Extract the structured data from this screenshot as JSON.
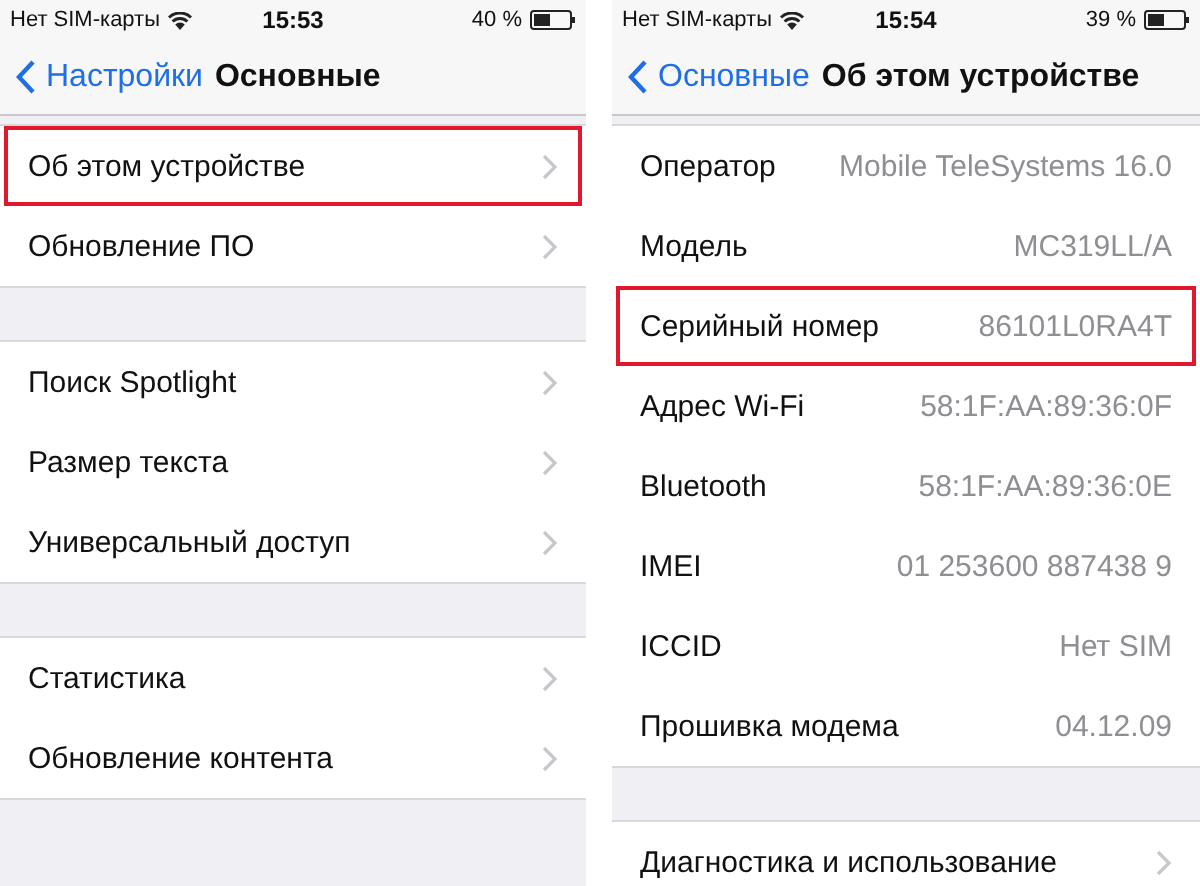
{
  "screens": [
    {
      "status_bar": {
        "carrier": "Нет SIM-карты",
        "time": "15:53",
        "battery": "40 %"
      },
      "nav": {
        "back": "Настройки",
        "title": "Основные"
      },
      "groups": [
        {
          "rows": [
            {
              "kind": "disclosure",
              "label": "Об этом устройстве",
              "highlighted": true
            },
            {
              "kind": "disclosure",
              "label": "Обновление ПО",
              "highlighted": false
            }
          ]
        },
        {
          "rows": [
            {
              "kind": "disclosure",
              "label": "Поиск Spotlight",
              "highlighted": false
            },
            {
              "kind": "disclosure",
              "label": "Размер текста",
              "highlighted": false
            },
            {
              "kind": "disclosure",
              "label": "Универсальный доступ",
              "highlighted": false
            }
          ]
        },
        {
          "rows": [
            {
              "kind": "disclosure",
              "label": "Статистика",
              "highlighted": false
            },
            {
              "kind": "disclosure",
              "label": "Обновление контента",
              "highlighted": false
            }
          ]
        }
      ]
    },
    {
      "status_bar": {
        "carrier": "Нет SIM-карты",
        "time": "15:54",
        "battery": "39 %"
      },
      "nav": {
        "back": "Основные",
        "title": "Об этом устройстве"
      },
      "groups": [
        {
          "rows": [
            {
              "kind": "info",
              "label": "Оператор",
              "value": "Mobile TeleSystems 16.0",
              "highlighted": false
            },
            {
              "kind": "info",
              "label": "Модель",
              "value": "MC319LL/A",
              "highlighted": false
            },
            {
              "kind": "info",
              "label": "Серийный номер",
              "value": "86101L0RA4T",
              "highlighted": true
            },
            {
              "kind": "info",
              "label": "Адрес Wi-Fi",
              "value": "58:1F:AA:89:36:0F",
              "highlighted": false
            },
            {
              "kind": "info",
              "label": "Bluetooth",
              "value": "58:1F:AA:89:36:0E",
              "highlighted": false
            },
            {
              "kind": "info",
              "label": "IMEI",
              "value": "01 253600 887438 9",
              "highlighted": false
            },
            {
              "kind": "info",
              "label": "ICCID",
              "value": "Нет SIM",
              "highlighted": false
            },
            {
              "kind": "info",
              "label": "Прошивка модема",
              "value": "04.12.09",
              "highlighted": false
            }
          ]
        },
        {
          "rows": [
            {
              "kind": "disclosure",
              "label": "Диагностика и использование",
              "highlighted": false
            }
          ]
        }
      ]
    }
  ]
}
